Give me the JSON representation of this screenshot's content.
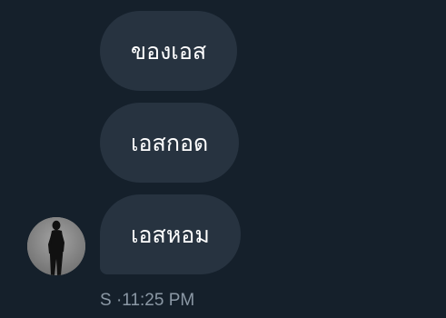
{
  "conversation": {
    "messages": [
      {
        "text": "ของเอส"
      },
      {
        "text": "เอสกอด"
      },
      {
        "text": "เอสหอม"
      }
    ],
    "sender_initial": "S",
    "separator": "·",
    "timestamp": "11:25 PM",
    "avatar_icon": "person-silhouette-icon"
  },
  "colors": {
    "background": "#15202b",
    "bubble": "#273340",
    "bubble_text": "#ffffff",
    "meta_text": "#8b98a5",
    "avatar_bg": "#8e8e8e"
  }
}
